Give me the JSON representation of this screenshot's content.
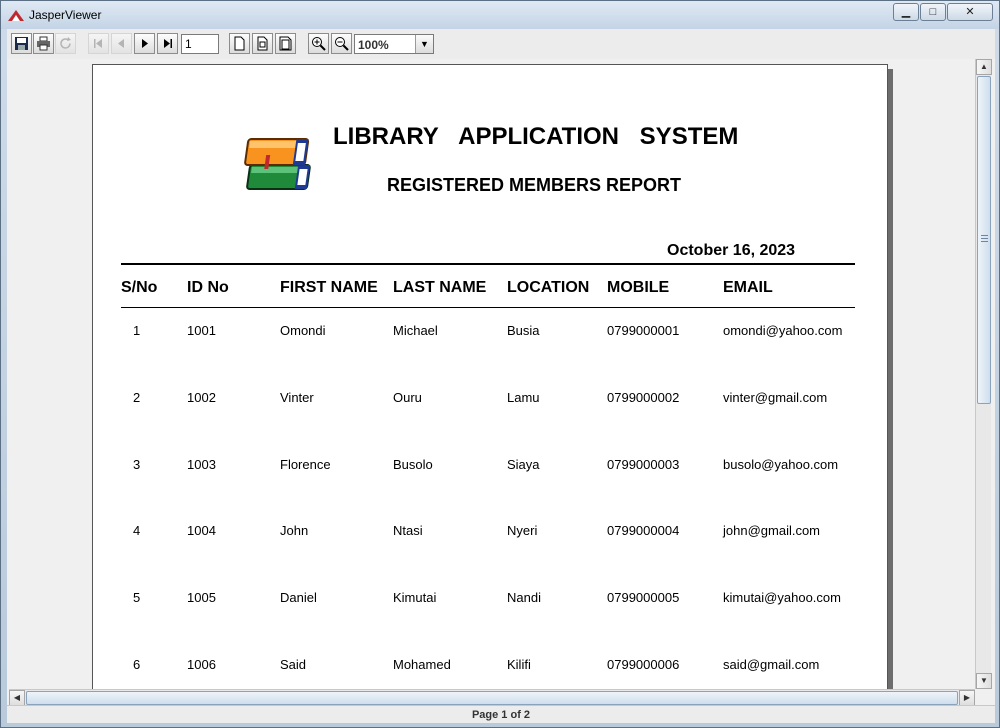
{
  "window": {
    "title": "JasperViewer",
    "controls": {
      "minimize": "▁",
      "maximize": "□",
      "close": "✕"
    }
  },
  "toolbar": {
    "icons": [
      "save-icon",
      "print-icon",
      "reload-icon",
      "first-page-icon",
      "previous-page-icon",
      "next-page-icon",
      "last-page-icon",
      "actual-size-icon",
      "fit-page-icon",
      "fit-width-icon",
      "zoom-in-icon",
      "zoom-out-icon"
    ],
    "page_number": "1",
    "zoom": "100%"
  },
  "report": {
    "title": "LIBRARY APPLICATION SYSTEM",
    "subtitle": "REGISTERED MEMBERS REPORT",
    "date": "October 16, 2023",
    "columns": [
      "S/No",
      "ID No",
      "FIRST NAME",
      "LAST NAME",
      "LOCATION",
      "MOBILE",
      "EMAIL"
    ],
    "rows": [
      [
        "1",
        "1001",
        "Omondi",
        "Michael",
        "Busia",
        "0799000001",
        "omondi@yahoo.com"
      ],
      [
        "2",
        "1002",
        "Vinter",
        "Ouru",
        "Lamu",
        "0799000002",
        "vinter@gmail.com"
      ],
      [
        "3",
        "1003",
        "Florence",
        "Busolo",
        "Siaya",
        "0799000003",
        "busolo@yahoo.com"
      ],
      [
        "4",
        "1004",
        "John",
        "Ntasi",
        "Nyeri",
        "0799000004",
        "john@gmail.com"
      ],
      [
        "5",
        "1005",
        "Daniel",
        "Kimutai",
        "Nandi",
        "0799000005",
        "kimutai@yahoo.com"
      ],
      [
        "6",
        "1006",
        "Said",
        "Mohamed",
        "Kilifi",
        "0799000006",
        "said@gmail.com"
      ]
    ]
  },
  "status": {
    "page_info": "Page 1 of 2"
  },
  "colors": {
    "book_orange": "#f7931e",
    "book_green": "#1e8a3a",
    "book_blue": "#1f3a93"
  }
}
